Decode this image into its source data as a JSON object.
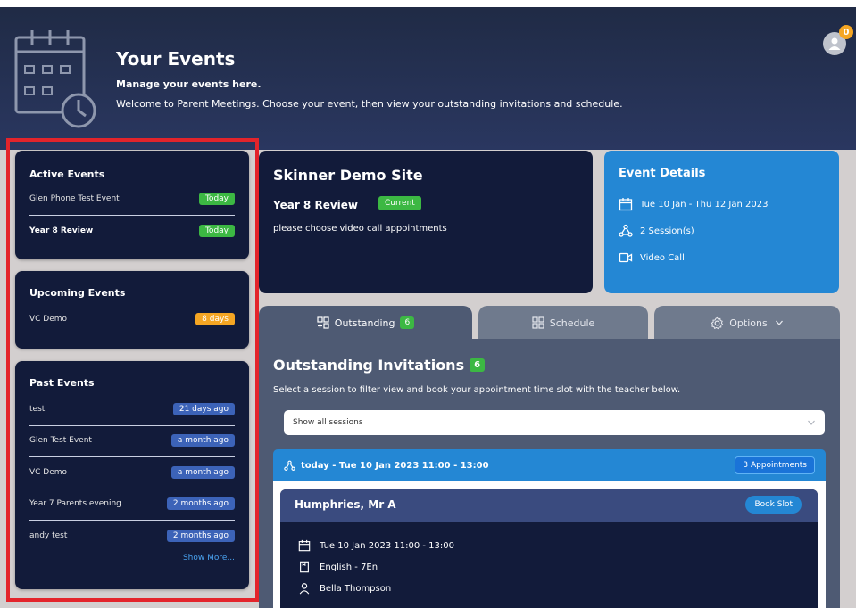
{
  "header": {
    "title": "Your Events",
    "subtitle": "Manage your events here.",
    "welcome": "Welcome to Parent Meetings. Choose your event, then view your outstanding invitations and schedule.",
    "notification_count": "0"
  },
  "sidebar": {
    "active": {
      "title": "Active Events",
      "items": [
        {
          "name": "Glen Phone Test Event",
          "badge": "Today"
        },
        {
          "name": "Year 8 Review",
          "badge": "Today"
        }
      ]
    },
    "upcoming": {
      "title": "Upcoming Events",
      "items": [
        {
          "name": "VC Demo",
          "badge": "8 days"
        }
      ]
    },
    "past": {
      "title": "Past Events",
      "items": [
        {
          "name": "test",
          "badge": "21 days ago"
        },
        {
          "name": "Glen Test Event",
          "badge": "a month ago"
        },
        {
          "name": "VC Demo",
          "badge": "a month ago"
        },
        {
          "name": "Year 7 Parents evening",
          "badge": "2 months ago"
        },
        {
          "name": "andy test",
          "badge": "2 months ago"
        }
      ],
      "show_more": "Show More..."
    }
  },
  "site": {
    "name": "Skinner Demo Site",
    "event": "Year 8 Review",
    "status": "Current",
    "description": "please choose video call appointments"
  },
  "details": {
    "title": "Event Details",
    "dates": "Tue 10 Jan - Thu 12 Jan 2023",
    "sessions": "2 Session(s)",
    "type": "Video Call"
  },
  "tabs": {
    "outstanding": "Outstanding",
    "outstanding_count": "6",
    "schedule": "Schedule",
    "options": "Options"
  },
  "outstanding": {
    "title": "Outstanding Invitations",
    "count": "6",
    "description": "Select a session to filter view and book your appointment time slot with the teacher below.",
    "select_value": "Show all sessions"
  },
  "session": {
    "label": "today - Tue 10 Jan 2023 11:00 - 13:00",
    "appointments": "3 Appointments"
  },
  "teacher": {
    "name": "Humphries, Mr A",
    "book_label": "Book Slot",
    "datetime": "Tue 10 Jan 2023 11:00 - 13:00",
    "subject": "English - 7En",
    "student": "Bella Thompson"
  },
  "colors": {
    "navy": "#121b3a",
    "accent_blue": "#2487d4",
    "green": "#3cb843",
    "orange": "#f5a623",
    "highlight_red": "#e3242b"
  }
}
